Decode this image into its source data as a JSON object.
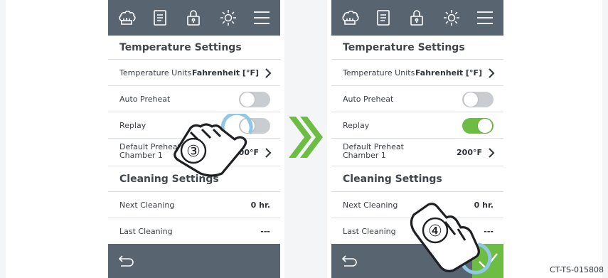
{
  "screens": [
    {
      "toolbar": {
        "icons": [
          "chef-hat-icon",
          "document-icon",
          "lock-icon",
          "sun-icon",
          "menu-icon"
        ]
      },
      "temperature_settings": {
        "title": "Temperature Settings",
        "temperature_units_label": "Temperature Units",
        "temperature_units_value": "Fahrenheit [°F]",
        "auto_preheat_label": "Auto Preheat",
        "auto_preheat_on": false,
        "replay_label": "Replay",
        "replay_on": false,
        "default_preheat_label_line1": "Default Preheat",
        "default_preheat_label_line2": "Chamber 1",
        "default_preheat_value": "200°F"
      },
      "cleaning_settings": {
        "title": "Cleaning Settings",
        "next_cleaning_label": "Next Cleaning",
        "next_cleaning_value": "0 hr.",
        "last_cleaning_label": "Last Cleaning",
        "last_cleaning_value": "---"
      },
      "step_marker": "③"
    },
    {
      "toolbar": {
        "icons": [
          "chef-hat-icon",
          "document-icon",
          "lock-icon",
          "sun-icon",
          "menu-icon"
        ]
      },
      "temperature_settings": {
        "title": "Temperature Settings",
        "temperature_units_label": "Temperature Units",
        "temperature_units_value": "Fahrenheit [°F]",
        "auto_preheat_label": "Auto Preheat",
        "auto_preheat_on": false,
        "replay_label": "Replay",
        "replay_on": true,
        "default_preheat_label_line1": "Default Preheat",
        "default_preheat_label_line2": "Chamber 1",
        "default_preheat_value": "200°F"
      },
      "cleaning_settings": {
        "title": "Cleaning Settings",
        "next_cleaning_label": "Next Cleaning",
        "next_cleaning_value": "0 hr.",
        "last_cleaning_label": "Last Cleaning",
        "last_cleaning_value": "---"
      },
      "step_marker": "④"
    }
  ],
  "colors": {
    "bar": "#586470",
    "accent_green": "#6dbd45",
    "toggle_off": "#c9ccd0"
  },
  "figure_code": "CT-TS-015808"
}
